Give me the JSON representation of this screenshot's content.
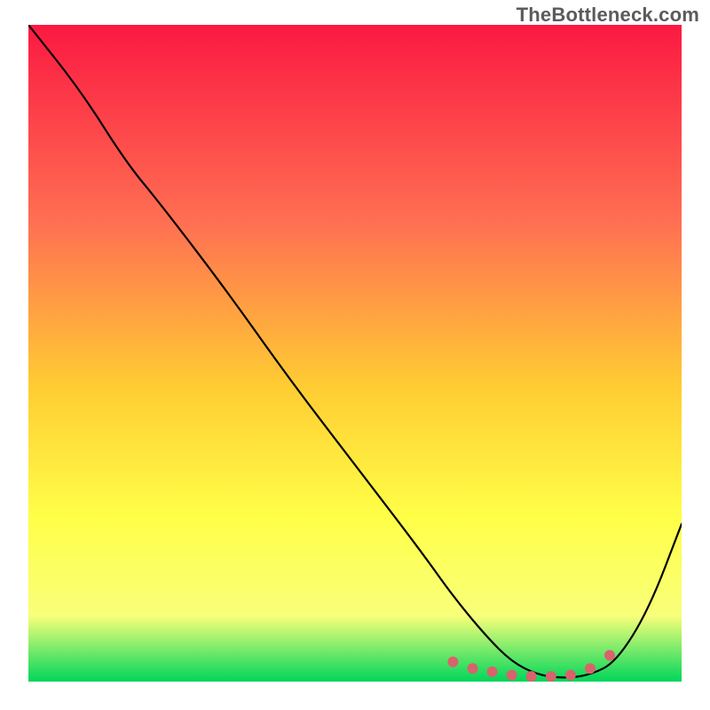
{
  "watermark": "TheBottleneck.com",
  "colors": {
    "curve": "#000000",
    "marker": "#d9626c",
    "grad_top": "#fb1942",
    "grad_mid1": "#ff6f52",
    "grad_mid2": "#ffcc33",
    "grad_mid3": "#ffff47",
    "grad_mid4": "#f8ff7a",
    "grad_bot": "#00d65b"
  },
  "chart_data": {
    "type": "line",
    "title": "",
    "xlabel": "",
    "ylabel": "",
    "xlim": [
      0,
      100
    ],
    "ylim": [
      0,
      100
    ],
    "x": [
      0,
      8,
      15,
      20,
      30,
      40,
      50,
      60,
      65,
      70,
      74,
      78,
      82,
      86,
      90,
      95,
      100
    ],
    "values": [
      100,
      90,
      79,
      73,
      60,
      46,
      33,
      20,
      13,
      7,
      3,
      1,
      0.5,
      1,
      3,
      11,
      24
    ],
    "optimum_markers_x": [
      65,
      68,
      71,
      74,
      77,
      80,
      83,
      86,
      89
    ],
    "optimum_markers_y": [
      3,
      2,
      1.5,
      1,
      0.8,
      0.8,
      1,
      2,
      4
    ],
    "note": "x and y are in percent of the axis span; values are approximate readings from the plotted curve."
  }
}
